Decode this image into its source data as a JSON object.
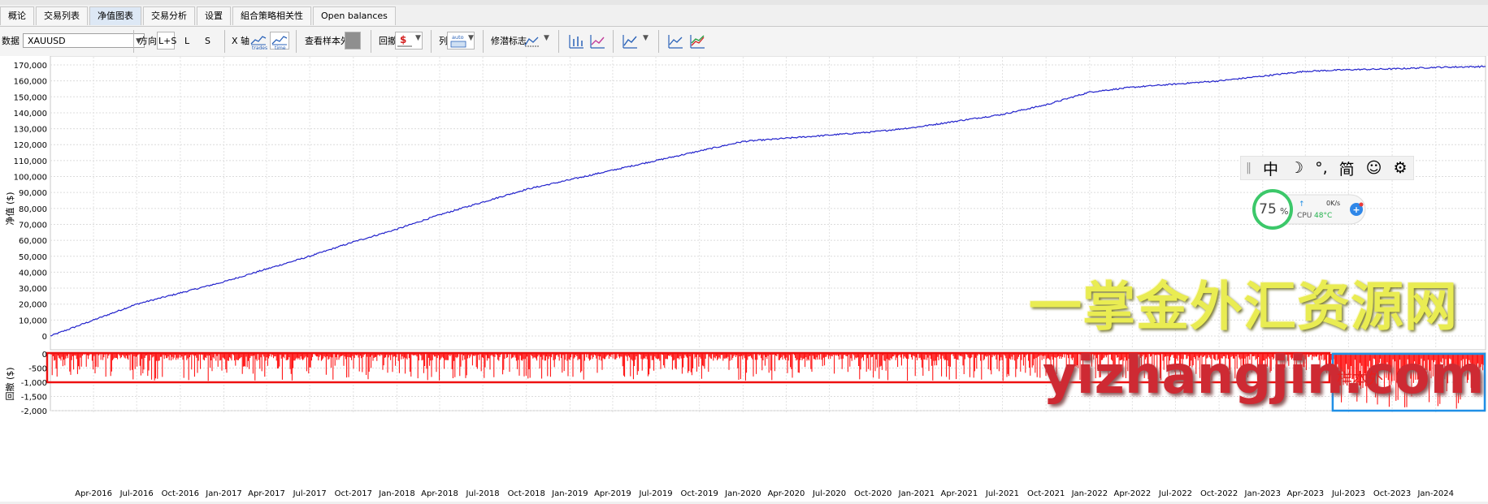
{
  "tabs": [
    {
      "label": "概论",
      "active": false
    },
    {
      "label": "交易列表",
      "active": false
    },
    {
      "label": "净值图表",
      "active": true
    },
    {
      "label": "交易分析",
      "active": false
    },
    {
      "label": "设置",
      "active": false
    },
    {
      "label": "組合策略相关性",
      "active": false
    },
    {
      "label": "Open balances",
      "active": false
    }
  ],
  "toolbar": {
    "data_label": "数据",
    "symbol_value": "XAUUSD",
    "direction_label": "方向",
    "direction_options": [
      "L+S",
      "L",
      "S"
    ],
    "direction_selected": "L+S",
    "xaxis_label": "X 轴",
    "xaxis_trades": "trades",
    "xaxis_time": "time",
    "oos_label": "查看样本外",
    "drawdown_label": "回撤",
    "columns_label": "列",
    "columns_auto": "auto",
    "benchmark_label": "修潜标志"
  },
  "overlay": {
    "ime_items": [
      "中",
      "☽",
      "°,",
      "简",
      "☺",
      "⚙"
    ],
    "cpu_percent": "75",
    "cpu_percent_sign": "%",
    "cpu_label": "CPU",
    "cpu_temp": "48°C",
    "net_speed": "0K/s",
    "net_arrow": "↑",
    "plus": "+"
  },
  "watermark": {
    "line1": "一掌金外汇资源网",
    "line2": "yizhangjin.com",
    "oos_tag": "样本外"
  },
  "colors": {
    "equity": "#2222cc",
    "drawdown": "#ff0000",
    "in_sample_box": "#ee1111",
    "oos_box": "#1f8fe6",
    "accent_tab": "#dde8f5"
  },
  "chart_data": [
    {
      "type": "line",
      "ylabel": "净值 ($)",
      "ylim": [
        0,
        170000
      ],
      "yticks": [
        "170,000",
        "160,000",
        "150,000",
        "140,000",
        "130,000",
        "120,000",
        "110,000",
        "100,000",
        "90,000",
        "80,000",
        "70,000",
        "60,000",
        "50,000",
        "40,000",
        "30,000",
        "20,000",
        "10,000",
        "0"
      ],
      "grid": true,
      "x_dates": [
        "2016-01-01",
        "2016-04-01",
        "2016-07-01",
        "2016-10-01",
        "2017-01-01",
        "2017-04-01",
        "2017-07-01",
        "2017-10-01",
        "2018-01-01",
        "2018-04-01",
        "2018-07-01",
        "2018-10-01",
        "2019-01-01",
        "2019-04-01",
        "2019-07-01",
        "2019-10-01",
        "2020-01-01",
        "2020-04-01",
        "2020-07-01",
        "2020-10-01",
        "2021-01-01",
        "2021-04-01",
        "2021-07-01",
        "2021-10-01",
        "2022-01-01",
        "2022-04-01",
        "2022-07-01",
        "2022-10-01",
        "2023-01-01",
        "2023-04-01",
        "2023-07-01",
        "2023-10-01",
        "2024-01-01",
        "2024-04-15"
      ],
      "series": [
        {
          "values": [
            0,
            10000,
            20000,
            27000,
            34000,
            42000,
            50000,
            59000,
            67000,
            76000,
            84000,
            92000,
            98000,
            104000,
            110000,
            116000,
            122000,
            124000,
            126000,
            128000,
            131000,
            135000,
            139000,
            145000,
            153000,
            156000,
            158000,
            160000,
            163000,
            166000,
            167000,
            167500,
            168500,
            169000
          ]
        }
      ]
    },
    {
      "type": "bar",
      "ylabel": "回撤 ($)",
      "ylim": [
        -2000,
        0
      ],
      "yticks": [
        "0",
        "-500",
        "-1,000",
        "-1,500",
        "-2,000"
      ],
      "x_tick_labels": [
        "Apr-2016",
        "Jul-2016",
        "Oct-2016",
        "Jan-2017",
        "Apr-2017",
        "Jul-2017",
        "Oct-2017",
        "Jan-2018",
        "Apr-2018",
        "Jul-2018",
        "Oct-2018",
        "Jan-2019",
        "Apr-2019",
        "Jul-2019",
        "Oct-2019",
        "Jan-2020",
        "Apr-2020",
        "Jul-2020",
        "Oct-2020",
        "Jan-2021",
        "Apr-2021",
        "Jul-2021",
        "Oct-2021",
        "Jan-2022",
        "Apr-2022",
        "Jul-2022",
        "Oct-2022",
        "Jan-2023",
        "Apr-2023",
        "Jul-2023",
        "Oct-2023",
        "Jan-2024"
      ],
      "in_sample_max_drawdown": -950,
      "out_of_sample_max_drawdown": -1950,
      "out_of_sample_start": "2023-06-01"
    }
  ]
}
